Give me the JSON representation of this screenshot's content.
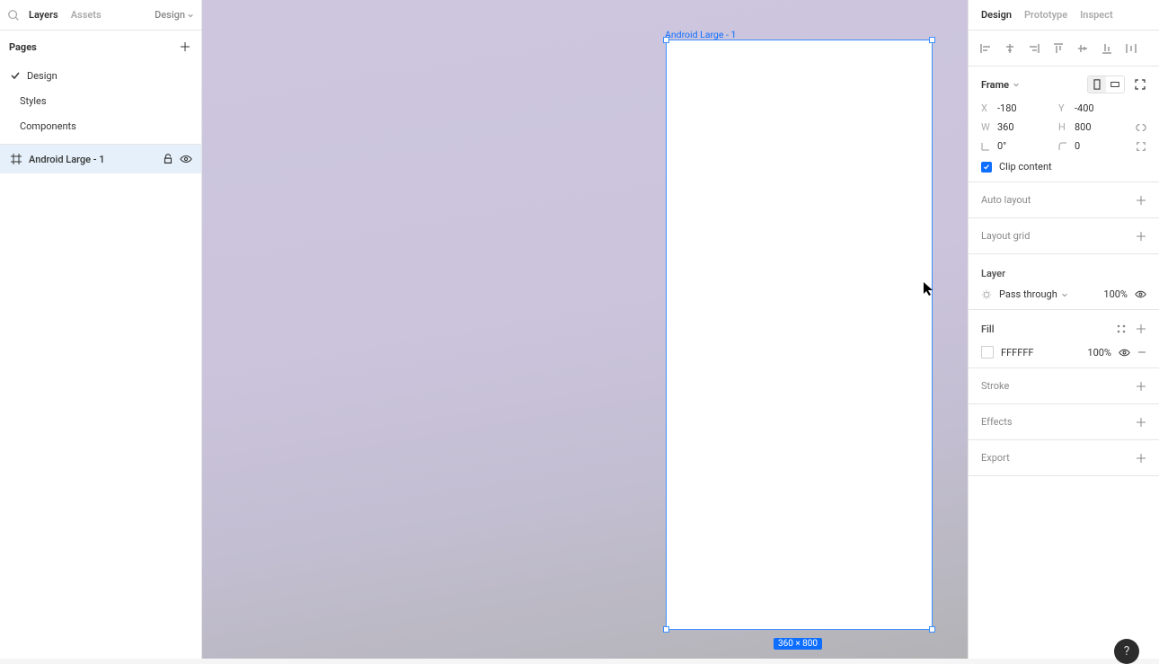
{
  "leftPanel": {
    "tabs": {
      "layers": "Layers",
      "assets": "Assets",
      "design": "Design"
    },
    "pagesHeader": "Pages",
    "pages": [
      {
        "name": "Design",
        "active": true
      },
      {
        "name": "Styles",
        "active": false
      },
      {
        "name": "Components",
        "active": false
      }
    ],
    "layers": [
      {
        "name": "Android Large - 1"
      }
    ]
  },
  "canvas": {
    "frameLabel": "Android Large - 1",
    "dimensions": "360 × 800"
  },
  "rightPanel": {
    "tabs": {
      "design": "Design",
      "prototype": "Prototype",
      "inspect": "Inspect"
    },
    "frame": {
      "label": "Frame",
      "x": "-180",
      "y": "-400",
      "w": "360",
      "h": "800",
      "rotation": "0°",
      "radius": "0",
      "clipContent": "Clip content"
    },
    "autoLayout": "Auto layout",
    "layoutGrid": "Layout grid",
    "layer": {
      "label": "Layer",
      "blendMode": "Pass through",
      "opacity": "100%"
    },
    "fill": {
      "label": "Fill",
      "hex": "FFFFFF",
      "opacity": "100%"
    },
    "stroke": "Stroke",
    "effects": "Effects",
    "export": "Export"
  },
  "labels": {
    "x": "X",
    "y": "Y",
    "w": "W",
    "h": "H"
  },
  "help": "?"
}
